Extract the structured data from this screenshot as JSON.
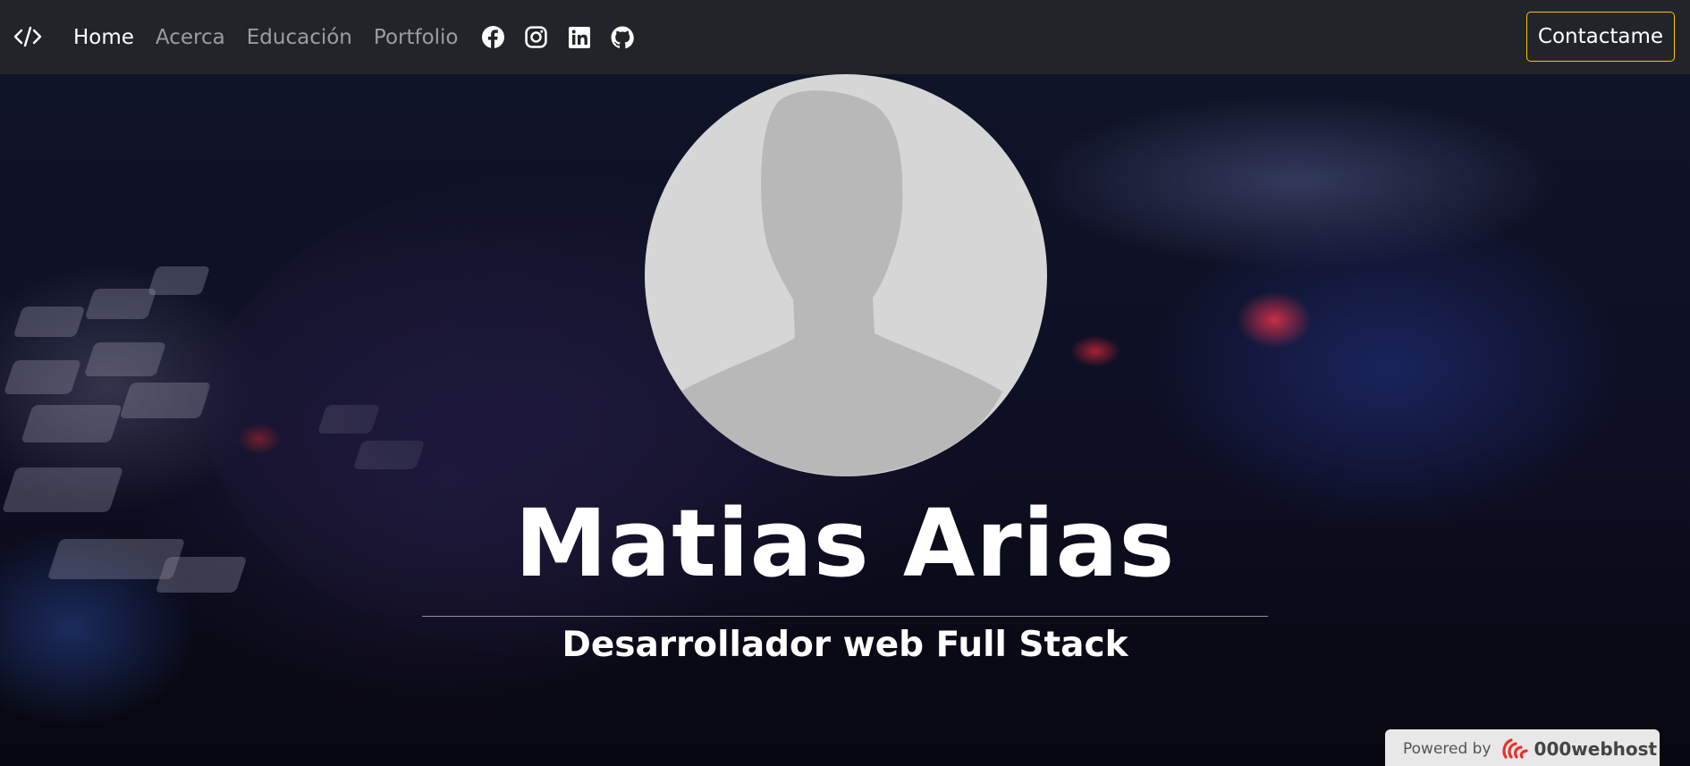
{
  "navbar": {
    "brand_icon": "code-icon",
    "links": [
      {
        "label": "Home",
        "active": true
      },
      {
        "label": "Acerca",
        "active": false
      },
      {
        "label": "Educación",
        "active": false
      },
      {
        "label": "Portfolio",
        "active": false
      }
    ],
    "social_icons": [
      "facebook-icon",
      "instagram-icon",
      "linkedin-icon",
      "github-icon"
    ],
    "contact_label": "Contactame"
  },
  "hero": {
    "avatar_icon": "profile-placeholder-icon",
    "name": "Matias Arias",
    "subtitle": "Desarrollador web Full Stack"
  },
  "badge": {
    "prefix": "Powered by",
    "brand": "000webhost"
  },
  "colors": {
    "navbar_bg": "#212529",
    "contact_border": "#ffc107",
    "avatar_bg": "#d6d6d6",
    "avatar_silhouette": "#b8b8b8"
  }
}
